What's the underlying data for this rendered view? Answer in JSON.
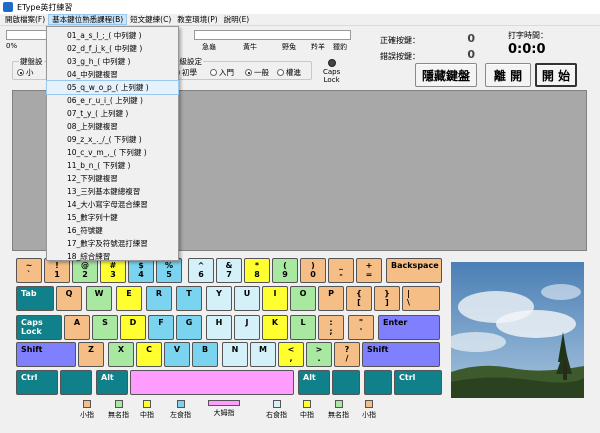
{
  "window": {
    "title": "EType英打練習"
  },
  "menu": [
    {
      "label": "開啟檔案(F)"
    },
    {
      "label": "基本鍵位熟悉課程(B)"
    },
    {
      "label": "短文鍵練(C)"
    },
    {
      "label": "教室環境(P)"
    },
    {
      "label": "說明(E)"
    }
  ],
  "dropdown": {
    "items": [
      {
        "label": "01_a_s_l_;_( 中列鍵 )"
      },
      {
        "label": "02_d_f_j_k_( 中列鍵 )"
      },
      {
        "label": "03_g_h_( 中列鍵 )"
      },
      {
        "label": "04_中列鍵複習"
      },
      {
        "label": "05_q_w_o_p_( 上列鍵 )"
      },
      {
        "label": "06_e_r_u_i_( 上列鍵 )"
      },
      {
        "label": "07_t_y_( 上列鍵 )"
      },
      {
        "label": "08_上列鍵複習"
      },
      {
        "label": "09_z_x_._/_( 下列鍵 )"
      },
      {
        "label": "10_c_v_m_,_( 下列鍵 )"
      },
      {
        "label": "11_b_n_( 下列鍵 )"
      },
      {
        "label": "12_下列鍵複習"
      },
      {
        "label": "13_三列基本鍵總複習"
      },
      {
        "label": "14_大小寫字母混合練習"
      },
      {
        "label": "15_數字列十鍵"
      },
      {
        "label": "16_符號鍵"
      },
      {
        "label": "17_數字及符號混打練習"
      },
      {
        "label": "18_綜合練習"
      }
    ],
    "highlighted_index": 4
  },
  "progress": {
    "percent_label": "0%",
    "animals": [
      "急龜",
      "黃牛",
      "野兔",
      "羚羊",
      "獵豹"
    ]
  },
  "stats": {
    "correct_label": "正確按鍵：",
    "correct_value": "0",
    "wrong_label": "錯誤按鍵：",
    "wrong_value": "0",
    "time_label": "打字時間：",
    "time_value": "0:0:0"
  },
  "settings": {
    "left_group_label": "鍵盤設",
    "left_option": "小",
    "level_group_label": "等級設定",
    "level_options": [
      {
        "label": "初學",
        "selected": false
      },
      {
        "label": "入門",
        "selected": false
      },
      {
        "label": "一般",
        "selected": true
      },
      {
        "label": "權進",
        "selected": false
      }
    ],
    "caps_label": "Caps",
    "lock_label": "Lock"
  },
  "buttons": {
    "hide_keyboard": "隱藏鍵盤",
    "leave": "離 開",
    "start": "開 始"
  },
  "finger_colors": {
    "pinky": "#f5be86",
    "ring": "#a8e8a0",
    "middle": "#ffff30",
    "index_l": "#7ad4f0",
    "index_r": "#d4f0f8",
    "thumb": "#ff9cff",
    "mod": "#10808a",
    "special": "#8080ff"
  },
  "keyboard": {
    "rows": [
      [
        {
          "top": "~",
          "bottom": "`",
          "f": "pinky"
        },
        {
          "top": "!",
          "bottom": "1",
          "f": "pinky"
        },
        {
          "top": "@",
          "bottom": "2",
          "f": "ring"
        },
        {
          "top": "#",
          "bottom": "3",
          "f": "middle"
        },
        {
          "top": "$",
          "bottom": "4",
          "f": "index_l"
        },
        {
          "top": "%",
          "bottom": "5",
          "f": "index_l"
        },
        {
          "top": "^",
          "bottom": "6",
          "f": "index_r"
        },
        {
          "top": "&",
          "bottom": "7",
          "f": "index_r"
        },
        {
          "top": "*",
          "bottom": "8",
          "f": "middle"
        },
        {
          "top": "(",
          "bottom": "9",
          "f": "ring"
        },
        {
          "top": ")",
          "bottom": "0",
          "f": "pinky"
        },
        {
          "top": "_",
          "bottom": "-",
          "f": "pinky"
        },
        {
          "top": "+",
          "bottom": "=",
          "f": "pinky"
        },
        {
          "top": "Backspace",
          "bottom": "",
          "f": "pinky"
        }
      ],
      [
        {
          "top": "Tab",
          "bottom": "",
          "f": "mod"
        },
        {
          "top": "Q",
          "bottom": "",
          "f": "pinky"
        },
        {
          "top": "W",
          "bottom": "",
          "f": "ring"
        },
        {
          "top": "E",
          "bottom": "",
          "f": "middle"
        },
        {
          "top": "R",
          "bottom": "",
          "f": "index_l"
        },
        {
          "top": "T",
          "bottom": "",
          "f": "index_l"
        },
        {
          "top": "Y",
          "bottom": "",
          "f": "index_r"
        },
        {
          "top": "U",
          "bottom": "",
          "f": "index_r"
        },
        {
          "top": "I",
          "bottom": "",
          "f": "middle"
        },
        {
          "top": "O",
          "bottom": "",
          "f": "ring"
        },
        {
          "top": "P",
          "bottom": "",
          "f": "pinky"
        },
        {
          "top": "{",
          "bottom": "[",
          "f": "pinky"
        },
        {
          "top": "}",
          "bottom": "]",
          "f": "pinky"
        },
        {
          "top": "|",
          "bottom": "\\",
          "f": "pinky"
        }
      ],
      [
        {
          "top": "Caps Lock",
          "bottom": "",
          "f": "mod"
        },
        {
          "top": "A",
          "bottom": "",
          "f": "pinky"
        },
        {
          "top": "S",
          "bottom": "",
          "f": "ring"
        },
        {
          "top": "D",
          "bottom": "",
          "f": "middle"
        },
        {
          "top": "F",
          "bottom": "",
          "f": "index_l"
        },
        {
          "top": "G",
          "bottom": "",
          "f": "index_l"
        },
        {
          "top": "H",
          "bottom": "",
          "f": "index_r"
        },
        {
          "top": "J",
          "bottom": "",
          "f": "index_r"
        },
        {
          "top": "K",
          "bottom": "",
          "f": "middle"
        },
        {
          "top": "L",
          "bottom": "",
          "f": "ring"
        },
        {
          "top": ":",
          "bottom": ";",
          "f": "pinky"
        },
        {
          "top": "\"",
          "bottom": "'",
          "f": "pinky"
        },
        {
          "top": "Enter",
          "bottom": "",
          "f": "special"
        }
      ],
      [
        {
          "top": "Shift",
          "bottom": "",
          "f": "special"
        },
        {
          "top": "Z",
          "bottom": "",
          "f": "pinky"
        },
        {
          "top": "X",
          "bottom": "",
          "f": "ring"
        },
        {
          "top": "C",
          "bottom": "",
          "f": "middle"
        },
        {
          "top": "V",
          "bottom": "",
          "f": "index_l"
        },
        {
          "top": "B",
          "bottom": "",
          "f": "index_l"
        },
        {
          "top": "N",
          "bottom": "",
          "f": "index_r"
        },
        {
          "top": "M",
          "bottom": "",
          "f": "index_r"
        },
        {
          "top": "<",
          "bottom": ",",
          "f": "middle"
        },
        {
          "top": ">",
          "bottom": ".",
          "f": "ring"
        },
        {
          "top": "?",
          "bottom": "/",
          "f": "pinky"
        },
        {
          "top": "Shift",
          "bottom": "",
          "f": "special"
        }
      ],
      [
        {
          "top": "Ctrl",
          "bottom": "",
          "f": "mod"
        },
        {
          "top": "",
          "bottom": "",
          "f": "mod"
        },
        {
          "top": "Alt",
          "bottom": "",
          "f": "mod"
        },
        {
          "top": "",
          "bottom": "",
          "f": "thumb"
        },
        {
          "top": "Alt",
          "bottom": "",
          "f": "mod"
        },
        {
          "top": "",
          "bottom": "",
          "f": "mod"
        },
        {
          "top": "",
          "bottom": "",
          "f": "mod"
        },
        {
          "top": "Ctrl",
          "bottom": "",
          "f": "mod"
        }
      ]
    ]
  },
  "legend": [
    {
      "label": "小指",
      "f": "pinky"
    },
    {
      "label": "無名指",
      "f": "ring"
    },
    {
      "label": "中指",
      "f": "middle"
    },
    {
      "label": "左食指",
      "f": "index_l"
    },
    {
      "label": "大姆指",
      "f": "thumb"
    },
    {
      "label": "右食指",
      "f": "index_r"
    },
    {
      "label": "中指",
      "f": "middle"
    },
    {
      "label": "無名指",
      "f": "ring"
    },
    {
      "label": "小指",
      "f": "pinky"
    }
  ]
}
